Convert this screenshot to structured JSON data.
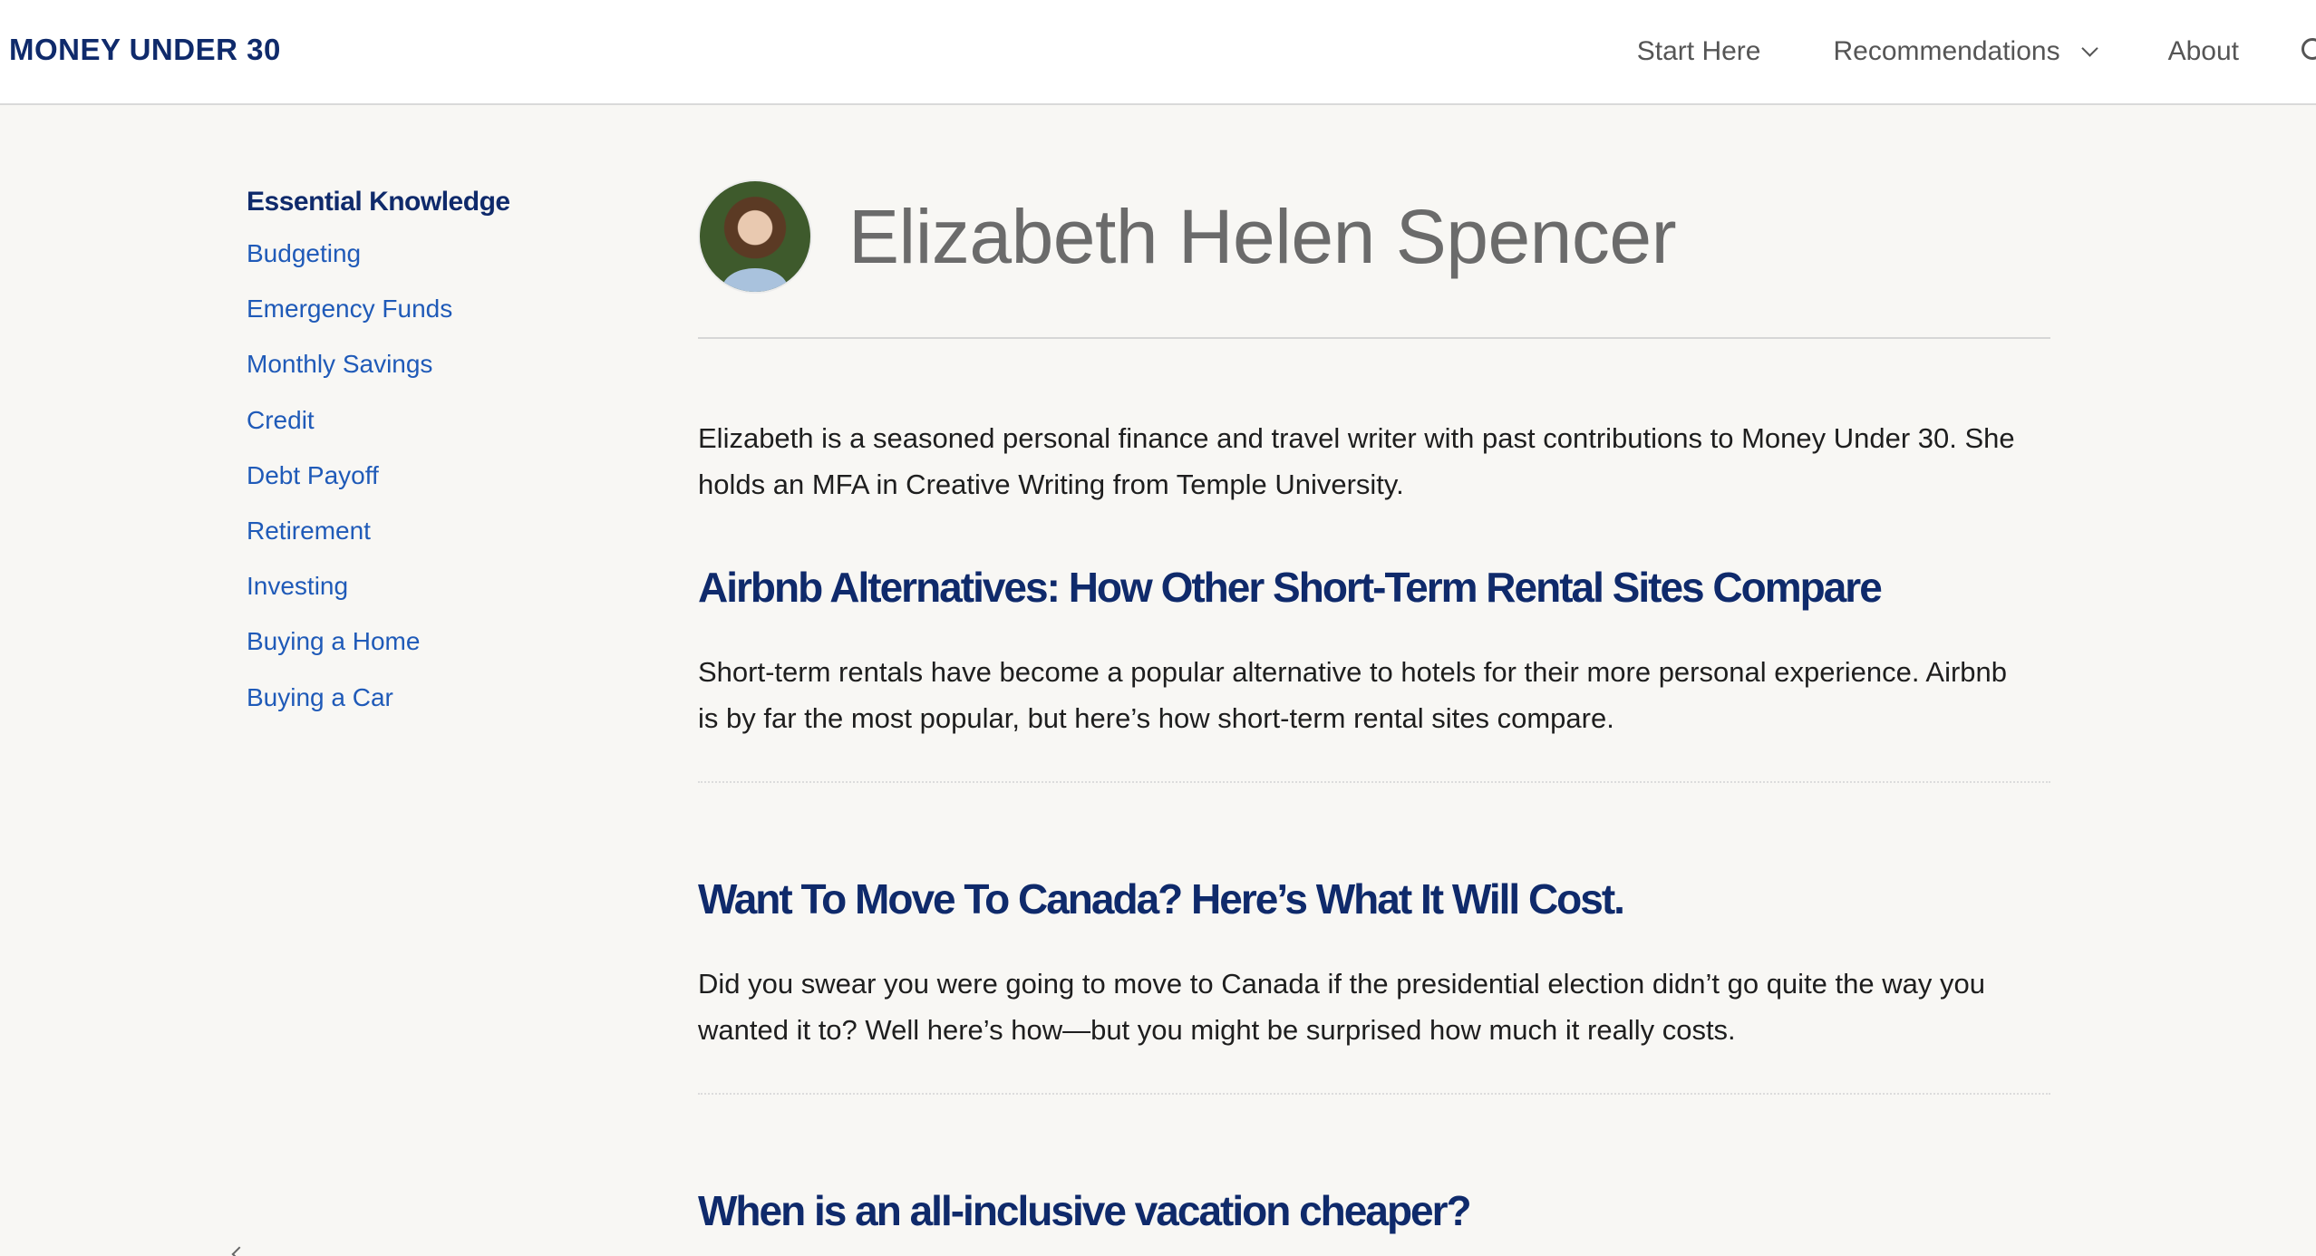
{
  "header": {
    "logo": "MONEY UNDER 30",
    "nav": [
      {
        "label": "Start Here"
      },
      {
        "label": "Recommendations"
      },
      {
        "label": "About"
      }
    ]
  },
  "sidebar": {
    "heading": "Essential Knowledge",
    "items": [
      {
        "label": "Budgeting"
      },
      {
        "label": "Emergency Funds"
      },
      {
        "label": "Monthly Savings"
      },
      {
        "label": "Credit"
      },
      {
        "label": "Debt Payoff"
      },
      {
        "label": "Retirement"
      },
      {
        "label": "Investing"
      },
      {
        "label": "Buying a Home"
      },
      {
        "label": "Buying a Car"
      }
    ]
  },
  "author": {
    "name": "Elizabeth Helen Spencer",
    "bio": "Elizabeth is a seasoned personal finance and travel writer with past contributions to Money Under 30. She holds an MFA in Creative Writing from Temple University."
  },
  "articles": [
    {
      "title": "Airbnb Alternatives: How Other Short-Term Rental Sites Compare",
      "excerpt": "Short-term rentals have become a popular alternative to hotels for their more personal experience. Airbnb is by far the most popular, but here’s how short-term rental sites compare."
    },
    {
      "title": "Want To Move To Canada? Here’s What It Will Cost.",
      "excerpt": "Did you swear you were going to move to Canada if the presidential election didn’t go quite the way you wanted it to? Well here’s how—but you might be surprised how much it really costs."
    },
    {
      "title": "When is an all-inclusive vacation cheaper?",
      "excerpt": ""
    }
  ]
}
